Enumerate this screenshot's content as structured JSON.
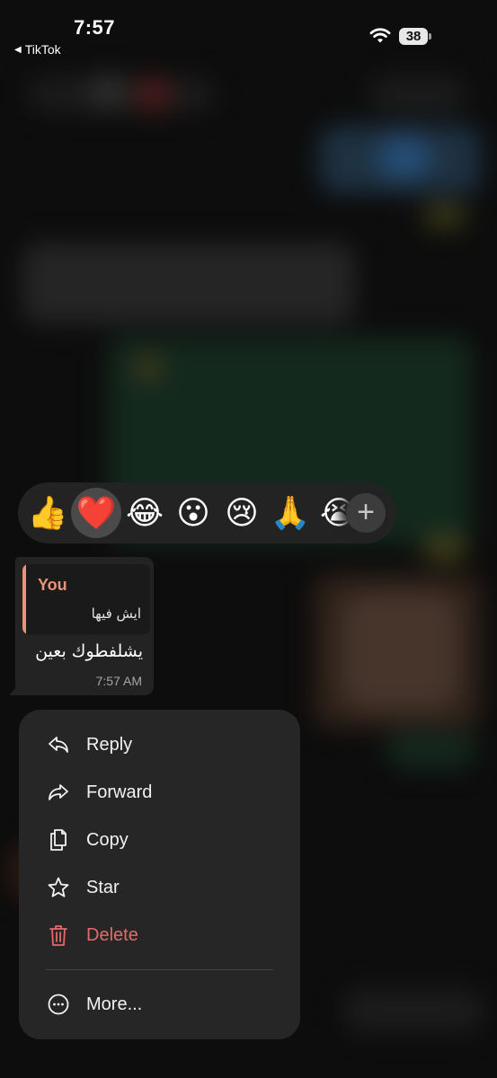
{
  "status_bar": {
    "time": "7:57",
    "back_app": "TikTok",
    "battery": "38"
  },
  "reactions": [
    {
      "emoji": "👍",
      "name": "thumbs-up",
      "selected": false
    },
    {
      "emoji": "❤️",
      "name": "heart",
      "selected": true
    },
    {
      "emoji": "😂",
      "name": "laughing",
      "selected": false
    },
    {
      "emoji": "😮",
      "name": "surprised",
      "selected": false
    },
    {
      "emoji": "😢",
      "name": "sad",
      "selected": false
    },
    {
      "emoji": "🙏",
      "name": "pray",
      "selected": false
    },
    {
      "emoji": "😭",
      "name": "crying",
      "selected": false
    }
  ],
  "reaction_more": "+",
  "message": {
    "quote_author": "You",
    "quote_text": "ايش فيها",
    "text": "يشلفطوك بعين",
    "time": "7:57 AM"
  },
  "menu": {
    "reply": "Reply",
    "forward": "Forward",
    "copy": "Copy",
    "star": "Star",
    "delete": "Delete",
    "more": "More..."
  },
  "colors": {
    "accent_quote": "#e8937a",
    "danger": "#e46a6a",
    "panel": "#262626",
    "bubble": "#232323"
  }
}
